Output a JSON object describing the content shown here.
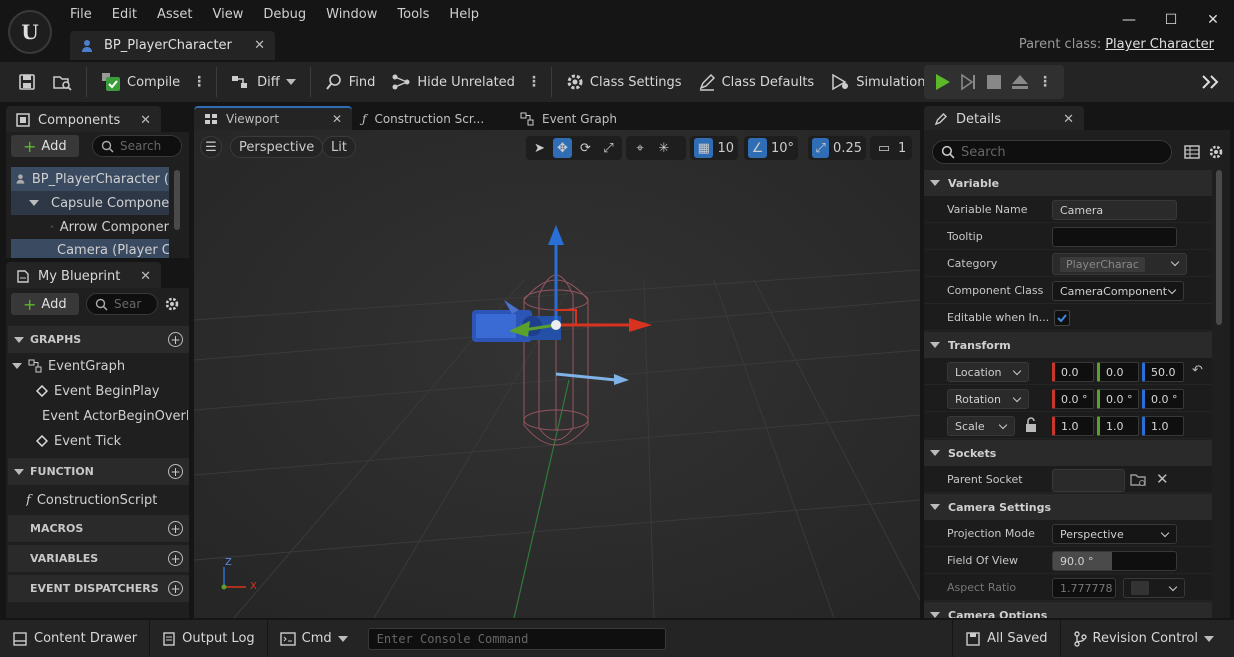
{
  "window": {
    "menu": [
      "File",
      "Edit",
      "Asset",
      "View",
      "Debug",
      "Window",
      "Tools",
      "Help"
    ],
    "doc_tab": "BP_PlayerCharacter",
    "parent_class_label": "Parent class:",
    "parent_class_value": "Player Character"
  },
  "toolbar": {
    "compile": "Compile",
    "diff": "Diff",
    "find": "Find",
    "hide_unrelated": "Hide Unrelated",
    "class_settings": "Class Settings",
    "class_defaults": "Class Defaults",
    "simulation": "Simulation"
  },
  "components": {
    "title": "Components",
    "add": "Add",
    "search_placeholder": "Search",
    "items": [
      "BP_PlayerCharacter (",
      "Capsule Componer",
      "Arrow Componer",
      "Camera (Player C"
    ]
  },
  "myblueprint": {
    "title": "My Blueprint",
    "add": "Add",
    "search_placeholder": "Sear",
    "graphs": "GRAPHS",
    "event_graph": "EventGraph",
    "events": [
      "Event BeginPlay",
      "Event ActorBeginOverla",
      "Event Tick"
    ],
    "function": "FUNCTION",
    "construction_script": "ConstructionScript",
    "macros": "MACROS",
    "variables": "VARIABLES",
    "event_dispatchers": "EVENT DISPATCHERS"
  },
  "tabs": {
    "viewport": "Viewport",
    "construction": "Construction Scr...",
    "event_graph": "Event Graph"
  },
  "viewport": {
    "perspective": "Perspective",
    "lit": "Lit",
    "grid_snap": "10",
    "rot_snap": "10°",
    "scale_snap": "0.25",
    "cam_speed": "1",
    "axis_z": "Z",
    "axis_x": "X"
  },
  "details": {
    "title": "Details",
    "search_placeholder": "Search",
    "variable": {
      "header": "Variable",
      "name_label": "Variable Name",
      "name_value": "Camera",
      "tooltip_label": "Tooltip",
      "tooltip_value": "",
      "category_label": "Category",
      "category_value": "PlayerCharac",
      "component_class_label": "Component Class",
      "component_class_value": "CameraComponent",
      "editable_label": "Editable when In...",
      "editable_checked": true
    },
    "transform": {
      "header": "Transform",
      "location": "Location",
      "loc": [
        "0.0",
        "0.0",
        "50.0"
      ],
      "rotation": "Rotation",
      "rot": [
        "0.0 °",
        "0.0 °",
        "0.0 °"
      ],
      "scale": "Scale",
      "scl": [
        "1.0",
        "1.0",
        "1.0"
      ]
    },
    "sockets": {
      "header": "Sockets",
      "parent_socket": "Parent Socket"
    },
    "camera": {
      "header": "Camera Settings",
      "projection_label": "Projection Mode",
      "projection_value": "Perspective",
      "fov_label": "Field Of View",
      "fov_value": "90.0 °",
      "aspect_label": "Aspect Ratio",
      "aspect_value": "1.777778"
    },
    "camera_options": "Camera Options"
  },
  "statusbar": {
    "content_drawer": "Content Drawer",
    "output_log": "Output Log",
    "cmd": "Cmd",
    "console_placeholder": "Enter Console Command",
    "all_saved": "All Saved",
    "revision_control": "Revision Control"
  },
  "colors": {
    "accent": "#2f6db5",
    "play": "#5cb82a",
    "gizmo_x": "#d8331f",
    "gizmo_y": "#5aa12c",
    "gizmo_z": "#2a6fd6"
  }
}
